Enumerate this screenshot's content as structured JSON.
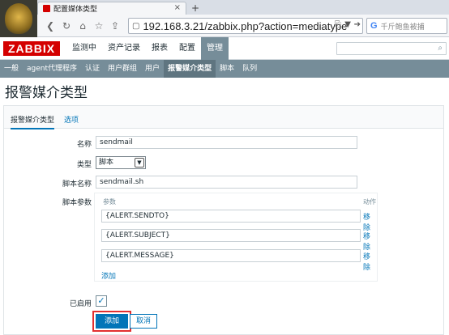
{
  "browser": {
    "tab_title": "配置媒体类型",
    "tab_close": "×",
    "new_tab": "+",
    "url": "192.168.3.21/zabbix.php?action=mediatype",
    "search_placeholder": "千斤鲍鱼被捕",
    "search_engine_letter": "G"
  },
  "zabbix": {
    "logo": "ZABBIX",
    "main_menu": [
      "监测中",
      "资产记录",
      "报表",
      "配置",
      "管理"
    ],
    "main_menu_active": "管理",
    "sub_menu": [
      "一般",
      "agent代理程序",
      "认证",
      "用户群组",
      "用户",
      "报警媒介类型",
      "脚本",
      "队列"
    ],
    "sub_menu_active": "报警媒介类型"
  },
  "page": {
    "title": "报警媒介类型",
    "tabs": [
      "报警媒介类型",
      "选项"
    ]
  },
  "form": {
    "name_label": "名称",
    "name_value": "sendmail",
    "type_label": "类型",
    "type_value": "脚本",
    "script_name_label": "脚本名称",
    "script_name_value": "sendmail.sh",
    "script_params_label": "脚本参数",
    "params_header": "参数",
    "action_header": "动作",
    "params": [
      "{ALERT.SENDTO}",
      "{ALERT.SUBJECT}",
      "{ALERT.MESSAGE}"
    ],
    "remove_label": "移除",
    "add_param_label": "添加",
    "enabled_label": "已启用",
    "enabled": true,
    "check_mark": "✓",
    "add_button": "添加",
    "cancel_button": "取消"
  },
  "colors": {
    "brand_red": "#d40000",
    "menu_gray": "#768d99",
    "link_blue": "#0275b8",
    "highlight_red": "#e23030"
  }
}
